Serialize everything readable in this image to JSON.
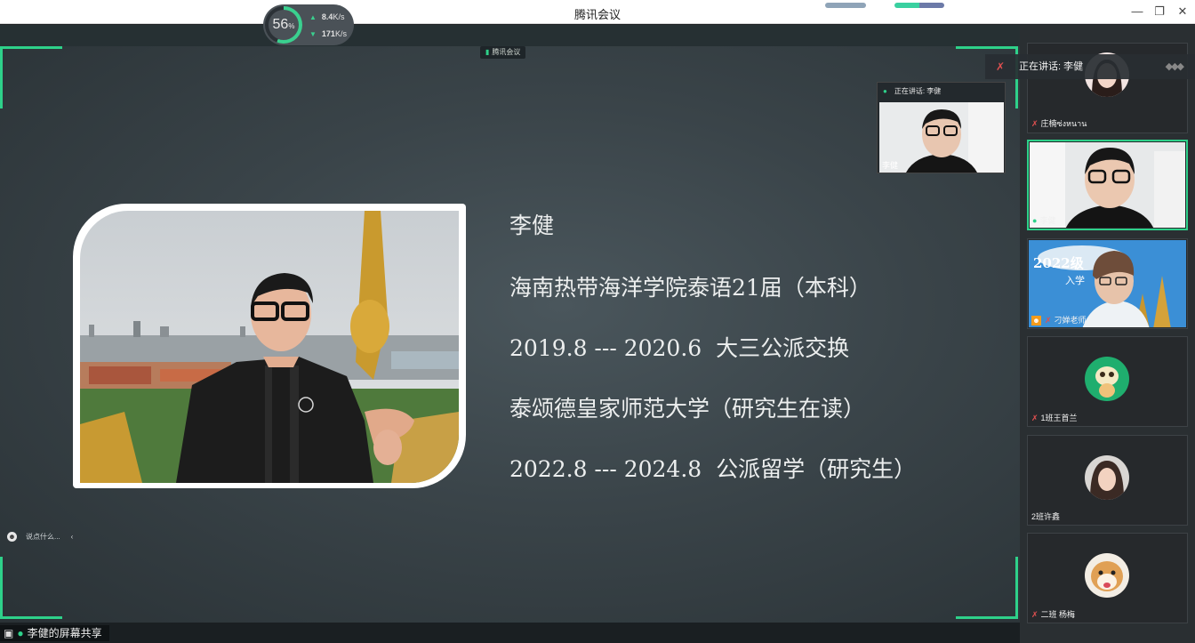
{
  "window": {
    "title": "腾讯会议"
  },
  "network": {
    "percent": "56",
    "percent_unit": "%",
    "upload": "8.4",
    "upload_unit": "K/s",
    "download": "171",
    "download_unit": "K/s"
  },
  "meeting_tag": "腾讯会议",
  "slide": {
    "lines": [
      "李健",
      "海南热带海洋学院泰语21届（本科）",
      "2019.8 --- 2020.6  大三公派交换",
      "泰颂德皇家师范大学（研究生在读）",
      "2022.8 --- 2024.8  公派留学（研究生）"
    ]
  },
  "pip": {
    "speaking": "正在讲话: 李健",
    "name": "李健"
  },
  "speaking_banner": "正在讲话: 李健",
  "chat_hint": "说点什么...",
  "share_label": "李健的屏幕共享",
  "participants": [
    {
      "name": "庄楠ซ่งหนาน",
      "mic": "off",
      "type": "avatar-girl"
    },
    {
      "name": "李健",
      "mic": "on",
      "type": "video",
      "active": true
    },
    {
      "name": "刁婵老师",
      "mic": "off",
      "type": "poster",
      "host": true,
      "poster_title": "2022级",
      "poster_sub": "入学"
    },
    {
      "name": "1班王首兰",
      "mic": "off",
      "type": "avatar-cartoon"
    },
    {
      "name": "2班许鑫",
      "mic": "none",
      "type": "avatar-girl2"
    },
    {
      "name": "二班  杨梅",
      "mic": "off",
      "type": "avatar-dog"
    }
  ]
}
